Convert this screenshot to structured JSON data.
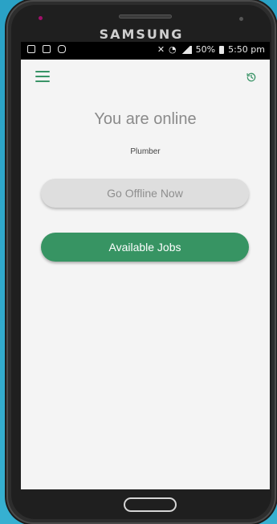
{
  "device": {
    "brand": "SAMSUNG"
  },
  "status_bar": {
    "battery_percent": "50%",
    "time": "5:50 pm"
  },
  "app": {
    "status_title": "You are online",
    "profession": "Plumber",
    "offline_button_label": "Go Offline Now",
    "jobs_button_label": "Available Jobs"
  },
  "icons": {
    "menu": "hamburger-menu-icon",
    "history": "history-icon"
  },
  "colors": {
    "primary_green": "#379463",
    "offline_button_bg": "#dedede",
    "screen_bg": "#f4f4f4"
  }
}
